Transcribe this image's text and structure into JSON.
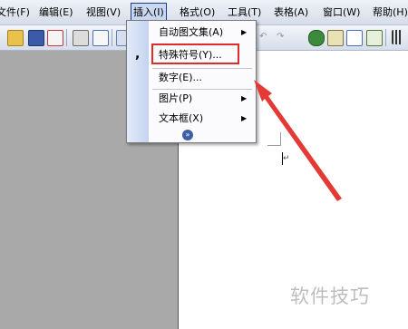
{
  "menubar": {
    "items": [
      {
        "label": "文件(F)"
      },
      {
        "label": "编辑(E)"
      },
      {
        "label": "视图(V)"
      },
      {
        "label": "插入(I)"
      },
      {
        "label": "格式(O)"
      },
      {
        "label": "工具(T)"
      },
      {
        "label": "表格(A)"
      },
      {
        "label": "窗口(W)"
      },
      {
        "label": "帮助(H)"
      }
    ]
  },
  "insert_menu": {
    "items": [
      {
        "label": "自动图文集(A)"
      },
      {
        "label": "特殊符号(Y)..."
      },
      {
        "label": "数字(E)..."
      },
      {
        "label": "图片(P)"
      },
      {
        "label": "文本框(X)"
      }
    ],
    "expand_glyph": "»"
  },
  "document": {
    "caret_tail": "↵"
  },
  "watermark": "软件技巧",
  "colors": {
    "highlight": "#e02b2b",
    "arrow": "#e53935",
    "menu_active": "#c9d7f1"
  }
}
